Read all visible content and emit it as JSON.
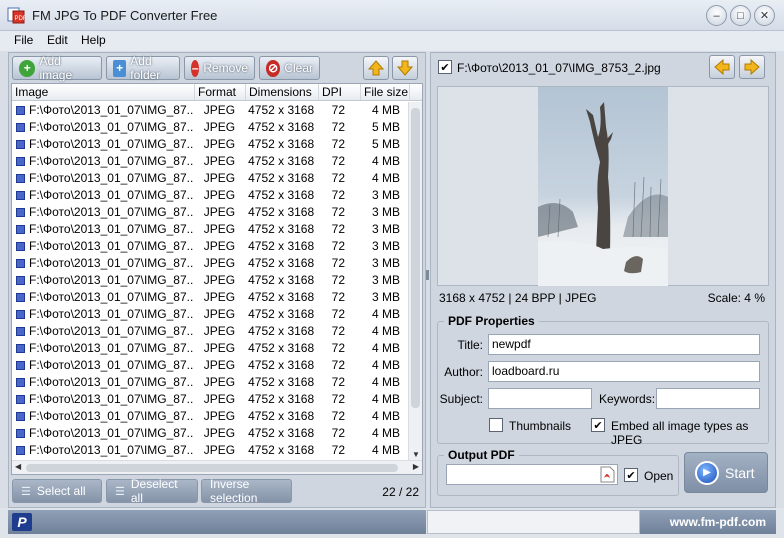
{
  "window": {
    "title": "FM JPG To PDF Converter Free"
  },
  "menu": [
    "File",
    "Edit",
    "Help"
  ],
  "toolbar": {
    "add_image": "Add image",
    "add_folder": "Add folder",
    "remove": "Remove",
    "clear": "Clear"
  },
  "grid": {
    "headers": [
      "Image",
      "Format",
      "Dimensions",
      "DPI",
      "File size"
    ],
    "rows": [
      {
        "image": "F:\\Фото\\2013_01_07\\IMG_87...",
        "format": "JPEG",
        "dimensions": "4752 x 3168",
        "dpi": "72",
        "size": "4 MB"
      },
      {
        "image": "F:\\Фото\\2013_01_07\\IMG_87...",
        "format": "JPEG",
        "dimensions": "4752 x 3168",
        "dpi": "72",
        "size": "5 MB"
      },
      {
        "image": "F:\\Фото\\2013_01_07\\IMG_87...",
        "format": "JPEG",
        "dimensions": "4752 x 3168",
        "dpi": "72",
        "size": "5 MB"
      },
      {
        "image": "F:\\Фото\\2013_01_07\\IMG_87...",
        "format": "JPEG",
        "dimensions": "4752 x 3168",
        "dpi": "72",
        "size": "4 MB"
      },
      {
        "image": "F:\\Фото\\2013_01_07\\IMG_87...",
        "format": "JPEG",
        "dimensions": "4752 x 3168",
        "dpi": "72",
        "size": "4 MB"
      },
      {
        "image": "F:\\Фото\\2013_01_07\\IMG_87...",
        "format": "JPEG",
        "dimensions": "4752 x 3168",
        "dpi": "72",
        "size": "3 MB"
      },
      {
        "image": "F:\\Фото\\2013_01_07\\IMG_87...",
        "format": "JPEG",
        "dimensions": "4752 x 3168",
        "dpi": "72",
        "size": "3 MB"
      },
      {
        "image": "F:\\Фото\\2013_01_07\\IMG_87...",
        "format": "JPEG",
        "dimensions": "4752 x 3168",
        "dpi": "72",
        "size": "3 MB"
      },
      {
        "image": "F:\\Фото\\2013_01_07\\IMG_87...",
        "format": "JPEG",
        "dimensions": "4752 x 3168",
        "dpi": "72",
        "size": "3 MB"
      },
      {
        "image": "F:\\Фото\\2013_01_07\\IMG_87...",
        "format": "JPEG",
        "dimensions": "4752 x 3168",
        "dpi": "72",
        "size": "3 MB"
      },
      {
        "image": "F:\\Фото\\2013_01_07\\IMG_87...",
        "format": "JPEG",
        "dimensions": "4752 x 3168",
        "dpi": "72",
        "size": "3 MB"
      },
      {
        "image": "F:\\Фото\\2013_01_07\\IMG_87...",
        "format": "JPEG",
        "dimensions": "4752 x 3168",
        "dpi": "72",
        "size": "3 MB"
      },
      {
        "image": "F:\\Фото\\2013_01_07\\IMG_87...",
        "format": "JPEG",
        "dimensions": "4752 x 3168",
        "dpi": "72",
        "size": "4 MB"
      },
      {
        "image": "F:\\Фото\\2013_01_07\\IMG_87...",
        "format": "JPEG",
        "dimensions": "4752 x 3168",
        "dpi": "72",
        "size": "4 MB"
      },
      {
        "image": "F:\\Фото\\2013_01_07\\IMG_87...",
        "format": "JPEG",
        "dimensions": "4752 x 3168",
        "dpi": "72",
        "size": "4 MB"
      },
      {
        "image": "F:\\Фото\\2013_01_07\\IMG_87...",
        "format": "JPEG",
        "dimensions": "4752 x 3168",
        "dpi": "72",
        "size": "4 MB"
      },
      {
        "image": "F:\\Фото\\2013_01_07\\IMG_87...",
        "format": "JPEG",
        "dimensions": "4752 x 3168",
        "dpi": "72",
        "size": "4 MB"
      },
      {
        "image": "F:\\Фото\\2013_01_07\\IMG_87...",
        "format": "JPEG",
        "dimensions": "4752 x 3168",
        "dpi": "72",
        "size": "4 MB"
      },
      {
        "image": "F:\\Фото\\2013_01_07\\IMG_87...",
        "format": "JPEG",
        "dimensions": "4752 x 3168",
        "dpi": "72",
        "size": "4 MB"
      },
      {
        "image": "F:\\Фото\\2013_01_07\\IMG_87...",
        "format": "JPEG",
        "dimensions": "4752 x 3168",
        "dpi": "72",
        "size": "4 MB"
      },
      {
        "image": "F:\\Фото\\2013_01_07\\IMG_87...",
        "format": "JPEG",
        "dimensions": "4752 x 3168",
        "dpi": "72",
        "size": "4 MB"
      }
    ]
  },
  "bottom": {
    "select_all": "Select all",
    "deselect_all": "Deselect all",
    "inverse_selection": "Inverse selection",
    "counter": "22 / 22"
  },
  "preview": {
    "path": "F:\\Фото\\2013_01_07\\IMG_8753_2.jpg",
    "info": "3168 x 4752  |  24 BPP  |  JPEG",
    "scale": "Scale: 4 %"
  },
  "pdf_properties": {
    "legend": "PDF Properties",
    "title_label": "Title:",
    "title_value": "newpdf",
    "author_label": "Author:",
    "author_value": "loadboard.ru",
    "subject_label": "Subject:",
    "subject_value": "",
    "keywords_label": "Keywords:",
    "keywords_value": "",
    "thumbnails_label": "Thumbnails",
    "embed_label": "Embed all image types as JPEG"
  },
  "output": {
    "legend": "Output PDF",
    "path": "",
    "open_label": "Open",
    "start_label": "Start"
  },
  "status": {
    "website": "www.fm-pdf.com"
  }
}
